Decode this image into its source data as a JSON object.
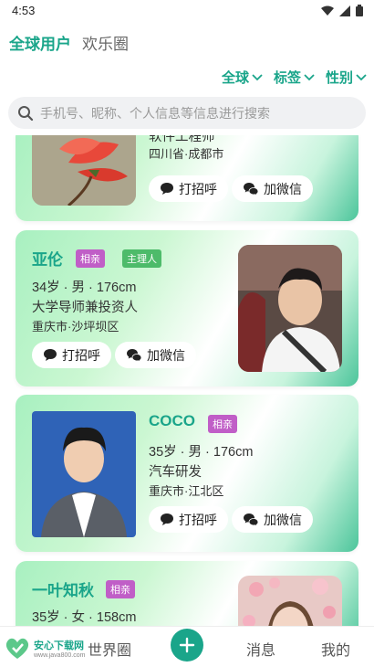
{
  "status": {
    "time": "4:53"
  },
  "top_tabs": [
    "全球用户",
    "欢乐圈"
  ],
  "filters": [
    "全球",
    "标签",
    "性别"
  ],
  "search": {
    "placeholder": "手机号、昵称、个人信息等信息进行搜索"
  },
  "actions": {
    "greet": "打招呼",
    "wechat": "加微信"
  },
  "cards": [
    {
      "occupation": "软件工程师",
      "location": "四川省·成都市"
    },
    {
      "name": "亚伦",
      "tags": [
        "相亲",
        "主理人"
      ],
      "stats": "34岁 · 男 · 176cm",
      "occupation": "大学导师兼投资人",
      "location": "重庆市·沙坪坝区"
    },
    {
      "name": "COCO",
      "tags": [
        "相亲"
      ],
      "stats": "35岁 · 男 · 176cm",
      "occupation": "汽车研发",
      "location": "重庆市·江北区"
    },
    {
      "name": "一叶知秋",
      "tags": [
        "相亲"
      ],
      "stats": "35岁 · 女 · 158cm"
    }
  ],
  "nav": {
    "world": "世界圈",
    "messages": "消息",
    "mine": "我的"
  },
  "watermark": {
    "title": "安心下载网",
    "url": "www.java800.com"
  },
  "colors": {
    "accent": "#1aa58a",
    "tag_pink": "#c05ec7",
    "tag_green": "#4dbb6a"
  }
}
